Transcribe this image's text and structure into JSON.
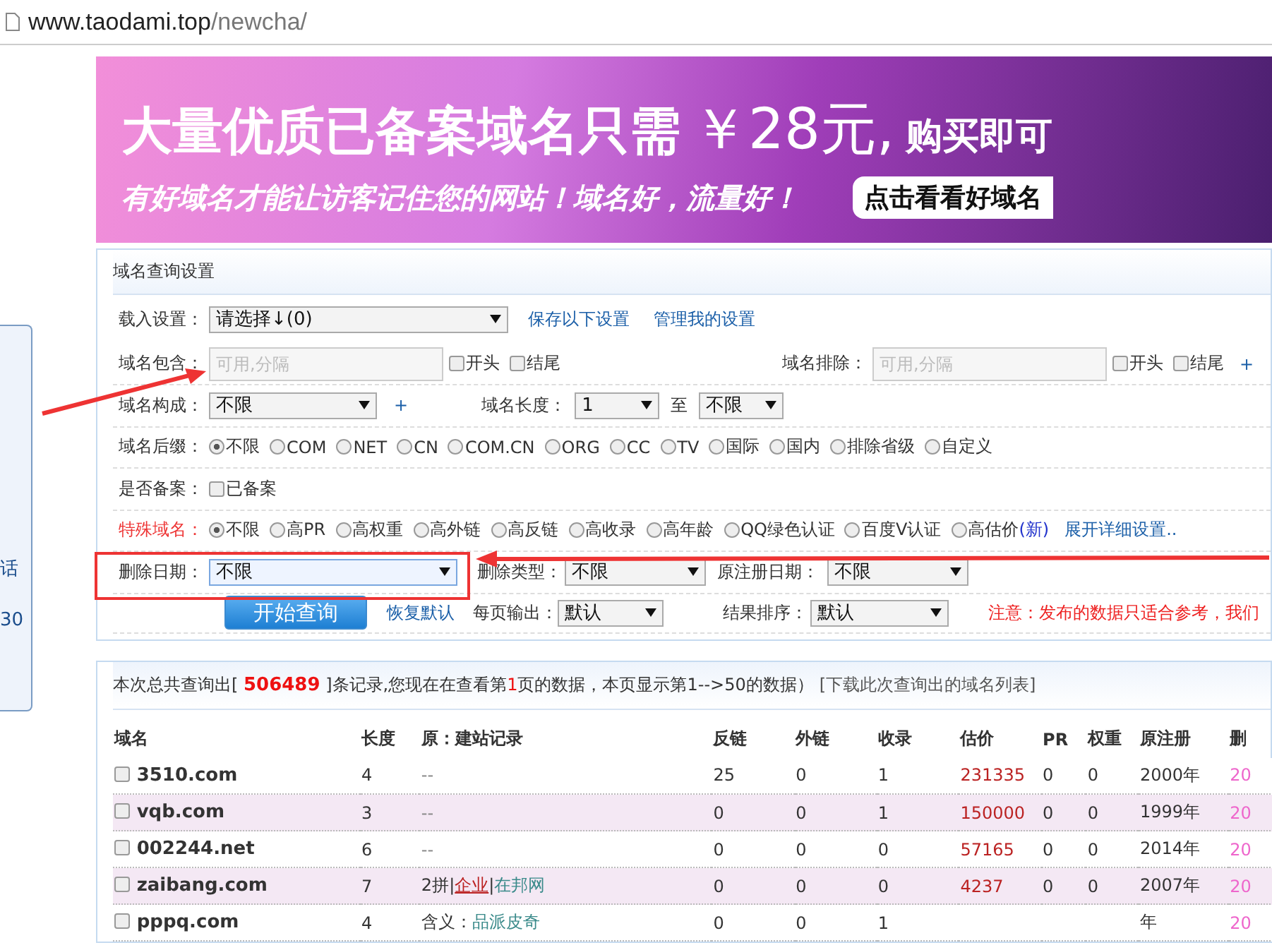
{
  "address_bar": {
    "host": "www.taodami.top",
    "path": "/newcha/"
  },
  "side_widget": {
    "texts": [
      "话",
      "30"
    ]
  },
  "banner": {
    "headline": "大量优质已备案域名只需",
    "price": "￥28元,",
    "headline_end": "购买即可",
    "slogan": "有好域名才能让访客记住您的网站！域名好，流量好！",
    "cta": "点击看看好域名"
  },
  "settings": {
    "title": "域名查询设置",
    "load": {
      "label": "载入设置：",
      "value": "请选择↓(0)",
      "links": [
        "保存以下设置",
        "管理我的设置"
      ]
    },
    "include": {
      "label": "域名包含：",
      "placeholder": "可用,分隔",
      "checks": [
        {
          "label": "开头",
          "checked": false
        },
        {
          "label": "结尾",
          "checked": false
        }
      ]
    },
    "exclude": {
      "label": "域名排除：",
      "placeholder": "可用,分隔",
      "checks": [
        {
          "label": "开头",
          "checked": false
        },
        {
          "label": "结尾",
          "checked": false
        }
      ],
      "plus": "+"
    },
    "composition": {
      "label": "域名构成：",
      "value": "不限",
      "plus": "+"
    },
    "length": {
      "label": "域名长度：",
      "from": "1",
      "to_label": "至",
      "to": "不限"
    },
    "suffix": {
      "label": "域名后缀：",
      "options": [
        {
          "label": "不限",
          "selected": true
        },
        {
          "label": "COM",
          "selected": false
        },
        {
          "label": "NET",
          "selected": false
        },
        {
          "label": "CN",
          "selected": false
        },
        {
          "label": "COM.CN",
          "selected": false
        },
        {
          "label": "ORG",
          "selected": false
        },
        {
          "label": "CC",
          "selected": false
        },
        {
          "label": "TV",
          "selected": false
        },
        {
          "label": "国际",
          "selected": false
        },
        {
          "label": "国内",
          "selected": false
        },
        {
          "label": "排除省级",
          "selected": false
        },
        {
          "label": "自定义",
          "selected": false
        }
      ]
    },
    "filed": {
      "label": "是否备案：",
      "check": {
        "label": "已备案",
        "checked": false
      }
    },
    "special": {
      "label": "特殊域名：",
      "options": [
        {
          "label": "不限",
          "selected": true
        },
        {
          "label": "高PR",
          "selected": false
        },
        {
          "label": "高权重",
          "selected": false
        },
        {
          "label": "高外链",
          "selected": false
        },
        {
          "label": "高反链",
          "selected": false
        },
        {
          "label": "高收录",
          "selected": false
        },
        {
          "label": "高年龄",
          "selected": false
        },
        {
          "label": "QQ绿色认证",
          "selected": false
        },
        {
          "label": "百度V认证",
          "selected": false
        },
        {
          "label": "高估价",
          "selected": false,
          "badge": "(新)"
        }
      ],
      "more": "展开详细设置.."
    },
    "delete_date": {
      "label": "删除日期：",
      "value": "不限"
    },
    "delete_type": {
      "label": "删除类型：",
      "value": "不限"
    },
    "orig_reg_date": {
      "label": "原注册日期：",
      "value": "不限"
    },
    "search_button": "开始查询",
    "reset": "恢复默认",
    "per_page": {
      "label": "每页输出：",
      "value": "默认"
    },
    "sort": {
      "label": "结果排序：",
      "value": "默认"
    },
    "notice": "注意：发布的数据只适合参考，我们"
  },
  "results": {
    "summary": {
      "prefix": "本次总共查询出[ ",
      "count": "506489",
      "middle": " ]条记录,您现在在查看第",
      "page": "1",
      "suffix": "页的数据，本页显示第1-->50的数据）"
    },
    "download": "[下载此次查询出的域名列表]",
    "columns": [
      "域名",
      "长度",
      "原：建站记录",
      "反链",
      "外链",
      "收录",
      "估价",
      "PR",
      "权重",
      "原注册",
      "删"
    ],
    "rows": [
      {
        "domain": "3510.com",
        "checked": false,
        "length": "4",
        "record": [
          {
            "text": "--",
            "kind": "dim"
          }
        ],
        "backlinks": "25",
        "external": "0",
        "indexed": "1",
        "value": "231335",
        "pr": "0",
        "weight": "0",
        "registered": "2000年",
        "deleted": "20"
      },
      {
        "domain": "vqb.com",
        "checked": false,
        "length": "3",
        "record": [
          {
            "text": "--",
            "kind": "dim"
          }
        ],
        "backlinks": "0",
        "external": "0",
        "indexed": "1",
        "value": "150000",
        "pr": "0",
        "weight": "0",
        "registered": "1999年",
        "deleted": "20"
      },
      {
        "domain": "002244.net",
        "checked": false,
        "length": "6",
        "record": [
          {
            "text": "--",
            "kind": "dim"
          }
        ],
        "backlinks": "0",
        "external": "0",
        "indexed": "0",
        "value": "57165",
        "pr": "0",
        "weight": "0",
        "registered": "2014年",
        "deleted": "20"
      },
      {
        "domain": "zaibang.com",
        "checked": false,
        "length": "7",
        "record": [
          {
            "text": "2拼",
            "kind": "plain"
          },
          {
            "text": "|",
            "kind": "plain"
          },
          {
            "text": "企业",
            "kind": "red"
          },
          {
            "text": "|",
            "kind": "plain"
          },
          {
            "text": "在邦网",
            "kind": "teal"
          }
        ],
        "backlinks": "0",
        "external": "0",
        "indexed": "0",
        "value": "4237",
        "pr": "0",
        "weight": "0",
        "registered": "2007年",
        "deleted": "20"
      },
      {
        "domain": "pppq.com",
        "checked": false,
        "length": "4",
        "record": [
          {
            "text": "含义：",
            "kind": "plain"
          },
          {
            "text": "品派皮奇",
            "kind": "teal"
          }
        ],
        "backlinks": "0",
        "external": "0",
        "indexed": "1",
        "value": "",
        "pr": "",
        "weight": "",
        "registered": "年",
        "deleted": "20"
      }
    ]
  }
}
